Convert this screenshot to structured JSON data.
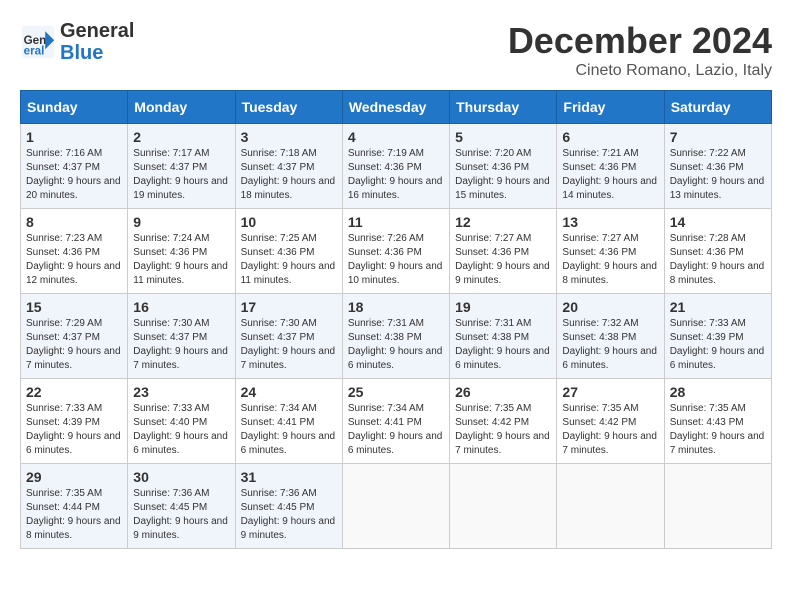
{
  "header": {
    "logo_line1": "General",
    "logo_line2": "Blue",
    "month": "December 2024",
    "location": "Cineto Romano, Lazio, Italy"
  },
  "days_of_week": [
    "Sunday",
    "Monday",
    "Tuesday",
    "Wednesday",
    "Thursday",
    "Friday",
    "Saturday"
  ],
  "weeks": [
    [
      {
        "day": "1",
        "sunrise": "Sunrise: 7:16 AM",
        "sunset": "Sunset: 4:37 PM",
        "daylight": "Daylight: 9 hours and 20 minutes."
      },
      {
        "day": "2",
        "sunrise": "Sunrise: 7:17 AM",
        "sunset": "Sunset: 4:37 PM",
        "daylight": "Daylight: 9 hours and 19 minutes."
      },
      {
        "day": "3",
        "sunrise": "Sunrise: 7:18 AM",
        "sunset": "Sunset: 4:37 PM",
        "daylight": "Daylight: 9 hours and 18 minutes."
      },
      {
        "day": "4",
        "sunrise": "Sunrise: 7:19 AM",
        "sunset": "Sunset: 4:36 PM",
        "daylight": "Daylight: 9 hours and 16 minutes."
      },
      {
        "day": "5",
        "sunrise": "Sunrise: 7:20 AM",
        "sunset": "Sunset: 4:36 PM",
        "daylight": "Daylight: 9 hours and 15 minutes."
      },
      {
        "day": "6",
        "sunrise": "Sunrise: 7:21 AM",
        "sunset": "Sunset: 4:36 PM",
        "daylight": "Daylight: 9 hours and 14 minutes."
      },
      {
        "day": "7",
        "sunrise": "Sunrise: 7:22 AM",
        "sunset": "Sunset: 4:36 PM",
        "daylight": "Daylight: 9 hours and 13 minutes."
      }
    ],
    [
      {
        "day": "8",
        "sunrise": "Sunrise: 7:23 AM",
        "sunset": "Sunset: 4:36 PM",
        "daylight": "Daylight: 9 hours and 12 minutes."
      },
      {
        "day": "9",
        "sunrise": "Sunrise: 7:24 AM",
        "sunset": "Sunset: 4:36 PM",
        "daylight": "Daylight: 9 hours and 11 minutes."
      },
      {
        "day": "10",
        "sunrise": "Sunrise: 7:25 AM",
        "sunset": "Sunset: 4:36 PM",
        "daylight": "Daylight: 9 hours and 11 minutes."
      },
      {
        "day": "11",
        "sunrise": "Sunrise: 7:26 AM",
        "sunset": "Sunset: 4:36 PM",
        "daylight": "Daylight: 9 hours and 10 minutes."
      },
      {
        "day": "12",
        "sunrise": "Sunrise: 7:27 AM",
        "sunset": "Sunset: 4:36 PM",
        "daylight": "Daylight: 9 hours and 9 minutes."
      },
      {
        "day": "13",
        "sunrise": "Sunrise: 7:27 AM",
        "sunset": "Sunset: 4:36 PM",
        "daylight": "Daylight: 9 hours and 8 minutes."
      },
      {
        "day": "14",
        "sunrise": "Sunrise: 7:28 AM",
        "sunset": "Sunset: 4:36 PM",
        "daylight": "Daylight: 9 hours and 8 minutes."
      }
    ],
    [
      {
        "day": "15",
        "sunrise": "Sunrise: 7:29 AM",
        "sunset": "Sunset: 4:37 PM",
        "daylight": "Daylight: 9 hours and 7 minutes."
      },
      {
        "day": "16",
        "sunrise": "Sunrise: 7:30 AM",
        "sunset": "Sunset: 4:37 PM",
        "daylight": "Daylight: 9 hours and 7 minutes."
      },
      {
        "day": "17",
        "sunrise": "Sunrise: 7:30 AM",
        "sunset": "Sunset: 4:37 PM",
        "daylight": "Daylight: 9 hours and 7 minutes."
      },
      {
        "day": "18",
        "sunrise": "Sunrise: 7:31 AM",
        "sunset": "Sunset: 4:38 PM",
        "daylight": "Daylight: 9 hours and 6 minutes."
      },
      {
        "day": "19",
        "sunrise": "Sunrise: 7:31 AM",
        "sunset": "Sunset: 4:38 PM",
        "daylight": "Daylight: 9 hours and 6 minutes."
      },
      {
        "day": "20",
        "sunrise": "Sunrise: 7:32 AM",
        "sunset": "Sunset: 4:38 PM",
        "daylight": "Daylight: 9 hours and 6 minutes."
      },
      {
        "day": "21",
        "sunrise": "Sunrise: 7:33 AM",
        "sunset": "Sunset: 4:39 PM",
        "daylight": "Daylight: 9 hours and 6 minutes."
      }
    ],
    [
      {
        "day": "22",
        "sunrise": "Sunrise: 7:33 AM",
        "sunset": "Sunset: 4:39 PM",
        "daylight": "Daylight: 9 hours and 6 minutes."
      },
      {
        "day": "23",
        "sunrise": "Sunrise: 7:33 AM",
        "sunset": "Sunset: 4:40 PM",
        "daylight": "Daylight: 9 hours and 6 minutes."
      },
      {
        "day": "24",
        "sunrise": "Sunrise: 7:34 AM",
        "sunset": "Sunset: 4:41 PM",
        "daylight": "Daylight: 9 hours and 6 minutes."
      },
      {
        "day": "25",
        "sunrise": "Sunrise: 7:34 AM",
        "sunset": "Sunset: 4:41 PM",
        "daylight": "Daylight: 9 hours and 6 minutes."
      },
      {
        "day": "26",
        "sunrise": "Sunrise: 7:35 AM",
        "sunset": "Sunset: 4:42 PM",
        "daylight": "Daylight: 9 hours and 7 minutes."
      },
      {
        "day": "27",
        "sunrise": "Sunrise: 7:35 AM",
        "sunset": "Sunset: 4:42 PM",
        "daylight": "Daylight: 9 hours and 7 minutes."
      },
      {
        "day": "28",
        "sunrise": "Sunrise: 7:35 AM",
        "sunset": "Sunset: 4:43 PM",
        "daylight": "Daylight: 9 hours and 7 minutes."
      }
    ],
    [
      {
        "day": "29",
        "sunrise": "Sunrise: 7:35 AM",
        "sunset": "Sunset: 4:44 PM",
        "daylight": "Daylight: 9 hours and 8 minutes."
      },
      {
        "day": "30",
        "sunrise": "Sunrise: 7:36 AM",
        "sunset": "Sunset: 4:45 PM",
        "daylight": "Daylight: 9 hours and 9 minutes."
      },
      {
        "day": "31",
        "sunrise": "Sunrise: 7:36 AM",
        "sunset": "Sunset: 4:45 PM",
        "daylight": "Daylight: 9 hours and 9 minutes."
      },
      null,
      null,
      null,
      null
    ]
  ]
}
